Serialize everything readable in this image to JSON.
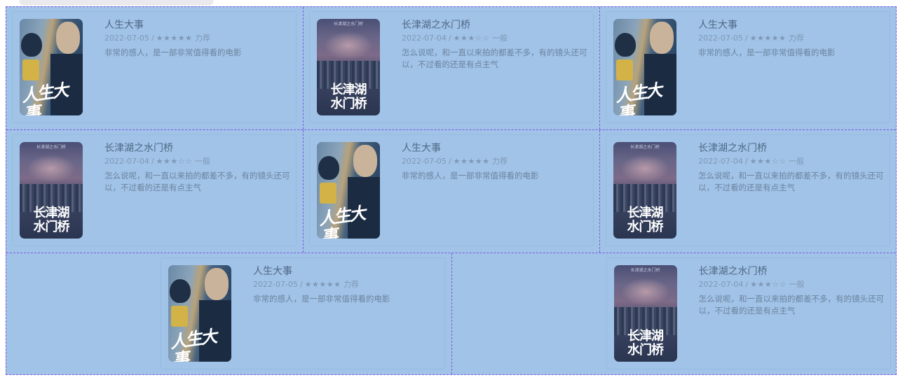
{
  "cards": [
    {
      "title": "人生大事",
      "date": "2022-07-05",
      "stars": "★★★★★",
      "rating_label": "力荐",
      "review": "非常的感人，是一部非常值得看的电影"
    },
    {
      "title": "长津湖之水门桥",
      "date": "2022-07-04",
      "stars": "★★★☆☆",
      "rating_label": "一般",
      "review": "怎么说呢，和一直以来拍的都差不多，有的镜头还可以，不过看的还是有点主气"
    },
    {
      "title": "人生大事",
      "date": "2022-07-05",
      "stars": "★★★★★",
      "rating_label": "力荐",
      "review": "非常的感人，是一部非常值得看的电影"
    },
    {
      "title": "长津湖之水门桥",
      "date": "2022-07-04",
      "stars": "★★★☆☆",
      "rating_label": "一般",
      "review": "怎么说呢，和一直以来拍的都差不多，有的镜头还可以，不过看的还是有点主气"
    },
    {
      "title": "人生大事",
      "date": "2022-07-05",
      "stars": "★★★★★",
      "rating_label": "力荐",
      "review": "非常的感人，是一部非常值得看的电影"
    },
    {
      "title": "长津湖之水门桥",
      "date": "2022-07-04",
      "stars": "★★★☆☆",
      "rating_label": "一般",
      "review": "怎么说呢，和一直以来拍的都差不多，有的镜头还可以，不过看的还是有点主气"
    },
    {
      "title": "人生大事",
      "date": "2022-07-05",
      "stars": "★★★★★",
      "rating_label": "力荐",
      "review": "非常的感人，是一部非常值得看的电影"
    },
    {
      "title": "长津湖之水门桥",
      "date": "2022-07-04",
      "stars": "★★★☆☆",
      "rating_label": "一般",
      "review": "怎么说呢，和一直以来拍的都差不多，有的镜头还可以，不过看的还是有点主气"
    }
  ],
  "posters": {
    "a": {
      "title_art": "人生大事"
    },
    "b": {
      "top_text": "长津湖之水门桥",
      "title_art_line1": "长津湖",
      "title_art_line2": "水门桥"
    }
  },
  "separator": "/",
  "colors": {
    "overlay": "#a1c3e8",
    "grid_border": "#7a5ce0",
    "title_text": "#4f6884",
    "meta_text": "#7e98b4"
  }
}
